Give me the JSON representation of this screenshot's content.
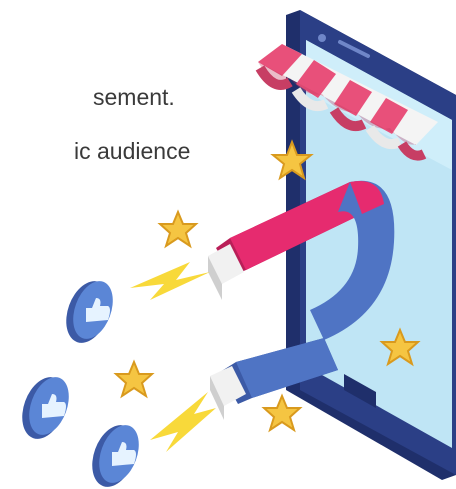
{
  "caption": {
    "line1": "sement.",
    "line2": "ic audience"
  },
  "colors": {
    "text": "#3a3a3a",
    "phone_body": "#2b3f86",
    "phone_screen": "#bfe5f5",
    "awning_red": "#e8507a",
    "magnet_pink": "#e62b6f",
    "magnet_blue": "#4f74c4",
    "star": "#f5c542",
    "like_badge": "#5b86d6",
    "lightning": "#f8d93a"
  },
  "icons": [
    "smartphone-icon",
    "shop-awning-icon",
    "magnet-icon",
    "thumbs-up-icon",
    "star-icon",
    "lightning-icon"
  ]
}
